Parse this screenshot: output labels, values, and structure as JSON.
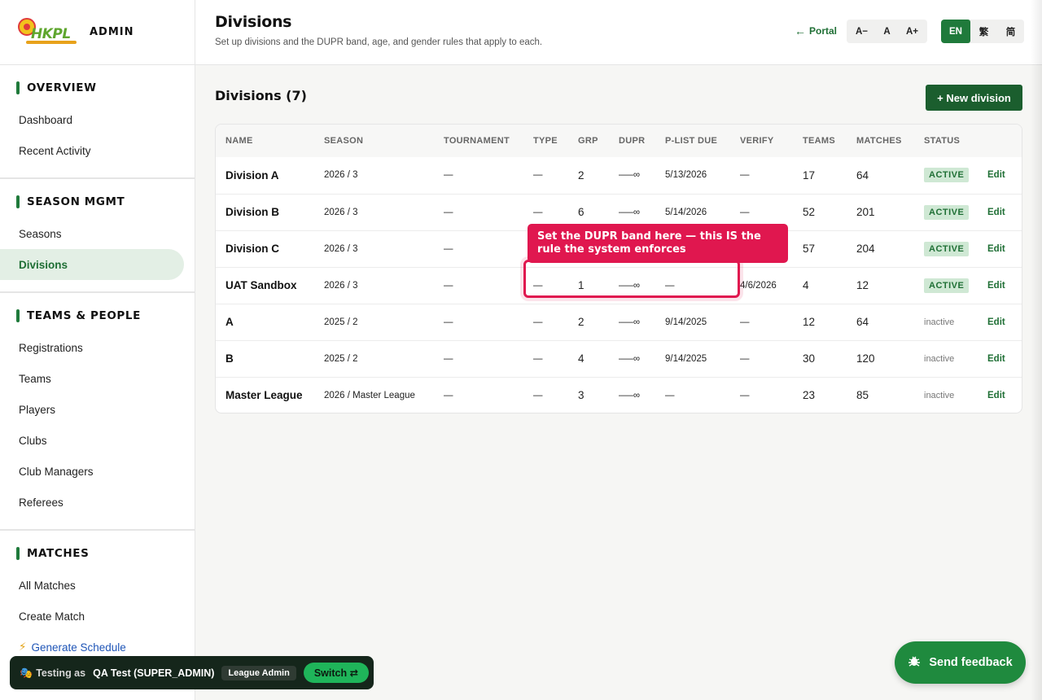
{
  "brand": {
    "logo_text": "HKPL",
    "title": "ADMIN"
  },
  "sidebar": {
    "sections": [
      {
        "title": "OVERVIEW",
        "items": [
          "Dashboard",
          "Recent Activity"
        ]
      },
      {
        "title": "SEASON MGMT",
        "items": [
          "Seasons",
          "Divisions"
        ]
      },
      {
        "title": "TEAMS & PEOPLE",
        "items": [
          "Registrations",
          "Teams",
          "Players",
          "Clubs",
          "Club Managers",
          "Referees"
        ]
      },
      {
        "title": "MATCHES",
        "items": [
          "All Matches",
          "Create Match",
          "Generate Schedule"
        ]
      }
    ],
    "active_item": "Divisions",
    "generate_icon": "⚡"
  },
  "header": {
    "title": "Divisions",
    "subtitle": "Set up divisions and the DUPR band, age, and gender rules that apply to each.",
    "portal_link": "Portal",
    "font_sizes": [
      "A−",
      "A",
      "A+"
    ],
    "languages": [
      "EN",
      "繁",
      "简"
    ],
    "active_language": "EN"
  },
  "content": {
    "title": "Divisions (7)",
    "new_button": "+ New division"
  },
  "table": {
    "columns": [
      "NAME",
      "SEASON",
      "TOURNAMENT",
      "TYPE",
      "GRP",
      "DUPR",
      "P-LIST DUE",
      "VERIFY",
      "TEAMS",
      "MATCHES",
      "STATUS",
      ""
    ],
    "rows": [
      {
        "name": "Division A",
        "season": "2026 / 3",
        "tournament": "—",
        "type": "—",
        "grp": "2",
        "dupr": "—–∞",
        "plist_due": "5/13/2026",
        "verify": "—",
        "teams": "17",
        "matches": "64",
        "status": "ACTIVE",
        "action": "Edit"
      },
      {
        "name": "Division B",
        "season": "2026 / 3",
        "tournament": "—",
        "type": "—",
        "grp": "6",
        "dupr": "—–∞",
        "plist_due": "5/14/2026",
        "verify": "—",
        "teams": "52",
        "matches": "201",
        "status": "ACTIVE",
        "action": "Edit"
      },
      {
        "name": "Division C",
        "season": "2026 / 3",
        "tournament": "—",
        "type": "",
        "grp": "",
        "dupr": "",
        "plist_due": "",
        "verify": "",
        "teams": "57",
        "matches": "204",
        "status": "ACTIVE",
        "action": "Edit"
      },
      {
        "name": "UAT Sandbox",
        "season": "2026 / 3",
        "tournament": "—",
        "type": "—",
        "grp": "1",
        "dupr": "—–∞",
        "plist_due": "—",
        "verify": "4/6/2026",
        "teams": "4",
        "matches": "12",
        "status": "ACTIVE",
        "action": "Edit"
      },
      {
        "name": "A",
        "season": "2025 / 2",
        "tournament": "—",
        "type": "—",
        "grp": "2",
        "dupr": "—–∞",
        "plist_due": "9/14/2025",
        "verify": "—",
        "teams": "12",
        "matches": "64",
        "status": "inactive",
        "action": "Edit"
      },
      {
        "name": "B",
        "season": "2025 / 2",
        "tournament": "—",
        "type": "—",
        "grp": "4",
        "dupr": "—–∞",
        "plist_due": "9/14/2025",
        "verify": "—",
        "teams": "30",
        "matches": "120",
        "status": "inactive",
        "action": "Edit"
      },
      {
        "name": "Master League",
        "season": "2026 / Master League",
        "tournament": "—",
        "type": "—",
        "grp": "3",
        "dupr": "—–∞",
        "plist_due": "—",
        "verify": "—",
        "teams": "23",
        "matches": "85",
        "status": "inactive",
        "action": "Edit"
      }
    ]
  },
  "tooltip": {
    "text": "Set the DUPR band here — this IS the rule the system enforces"
  },
  "testing_bar": {
    "icon": "🎭",
    "label": "Testing as",
    "user": "QA Test (SUPER_ADMIN)",
    "role": "League Admin",
    "switch_label": "Switch ⇄"
  },
  "feedback": {
    "label": "Send feedback",
    "icon": "bug-icon"
  },
  "colors": {
    "accent": "#1f7a3b",
    "highlight": "#e0174f",
    "link": "#1f55b7"
  }
}
